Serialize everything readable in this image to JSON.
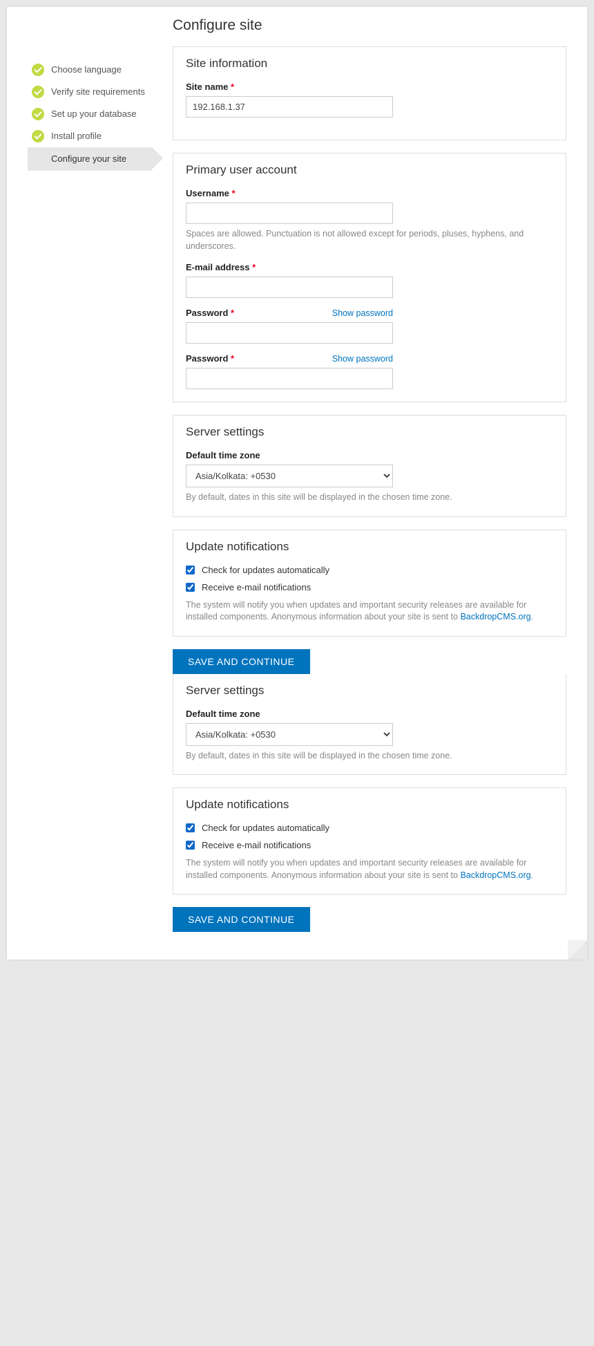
{
  "page_title": "Configure site",
  "sidebar": {
    "steps": [
      {
        "label": "Choose language",
        "done": true
      },
      {
        "label": "Verify site requirements",
        "done": true
      },
      {
        "label": "Set up your database",
        "done": true
      },
      {
        "label": "Install profile",
        "done": true
      },
      {
        "label": "Configure your site",
        "current": true
      }
    ]
  },
  "site_info": {
    "legend": "Site information",
    "site_name_label": "Site name",
    "site_name_value": "192.168.1.37"
  },
  "primary_user": {
    "legend": "Primary user account",
    "username_label": "Username",
    "username_value": "",
    "username_help": "Spaces are allowed. Punctuation is not allowed except for periods, pluses, hyphens, and underscores.",
    "email_label": "E-mail address",
    "email_value": "",
    "password_label": "Password",
    "password_confirm_label": "Password",
    "show_password": "Show password"
  },
  "server": {
    "legend": "Server settings",
    "tz_label": "Default time zone",
    "tz_value": "Asia/Kolkata: +0530",
    "tz_help": "By default, dates in this site will be displayed in the chosen time zone."
  },
  "updates": {
    "legend": "Update notifications",
    "check_label": "Check for updates automatically",
    "check_checked": true,
    "email_label": "Receive e-mail notifications",
    "email_checked": true,
    "note_pre": "The system will notify you when updates and important security releases are available for installed components. Anonymous information about your site is sent to ",
    "note_link": "BackdropCMS.org",
    "note_post": "."
  },
  "submit_label": "SAVE AND CONTINUE"
}
